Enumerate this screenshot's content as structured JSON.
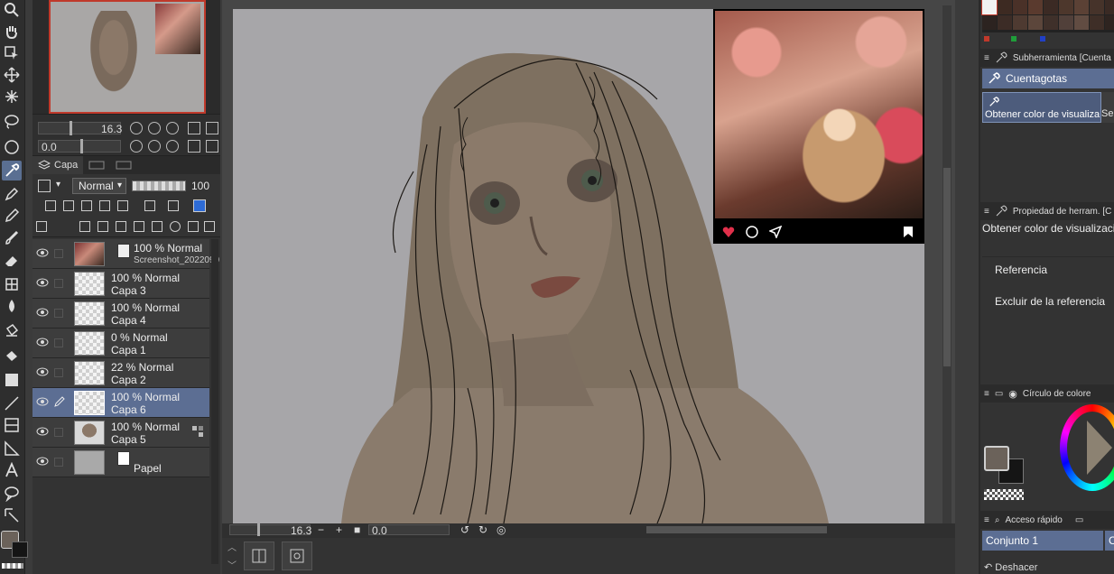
{
  "navigator": {
    "zoom": "16.3",
    "rotation": "0.0"
  },
  "layer_panel": {
    "tab_label": "Capa",
    "blend_mode": "Normal",
    "opacity": "100",
    "layers": [
      {
        "mode": "100 % Normal",
        "name": "Screenshot_2022090",
        "thumb": "photo",
        "type": "reference"
      },
      {
        "mode": "100 % Normal",
        "name": "Capa 3",
        "thumb": "transparent"
      },
      {
        "mode": "100 % Normal",
        "name": "Capa 4",
        "thumb": "transparent"
      },
      {
        "mode": "0 % Normal",
        "name": "Capa 1",
        "thumb": "transparent"
      },
      {
        "mode": "22 % Normal",
        "name": "Capa 2",
        "thumb": "transparent"
      },
      {
        "mode": "100 % Normal",
        "name": "Capa 6",
        "thumb": "transparent",
        "selected": true
      },
      {
        "mode": "100 % Normal",
        "name": "Capa 5",
        "thumb": "fig"
      },
      {
        "mode": "",
        "name": "Papel",
        "thumb": "paper",
        "type": "paper"
      }
    ]
  },
  "canvas_status": {
    "zoom": "16.3",
    "angle": "0.0"
  },
  "right_panel": {
    "subtool_title": "Subherramienta [Cuenta",
    "subtool_group": "Cuentagotas",
    "subtool_item": "Obtener color de visualiza",
    "subtool_item2": "Sele",
    "property_title": "Propiedad de herram. [C",
    "property_name": "Obtener color de visualización",
    "prop_reference": "Referencia",
    "prop_exclude": "Excluir de la referencia",
    "colorwheel_title": "Círculo de colore",
    "quick_access_title": "Acceso rápido",
    "quick_set": "Conjunto 1",
    "quick_set2": "Co",
    "undo_label": "Deshacer"
  },
  "swatch_colors": [
    "#f2f2f2",
    "#3d2a22",
    "#4a3128",
    "#5a3a2e",
    "#3b2a24",
    "#4d372c",
    "#5b4135",
    "#46332a",
    "#3a2a24",
    "#2c2320",
    "#3c2c26",
    "#4e3a31",
    "#5c463b",
    "#3f302a",
    "#51403a",
    "#614c42",
    "#3e2e27",
    "#2e2420"
  ],
  "colors": {
    "accent": "#5c6e93",
    "main_color": "#6b625a",
    "sub_color": "#151515",
    "nav_border": "#c0392b"
  }
}
